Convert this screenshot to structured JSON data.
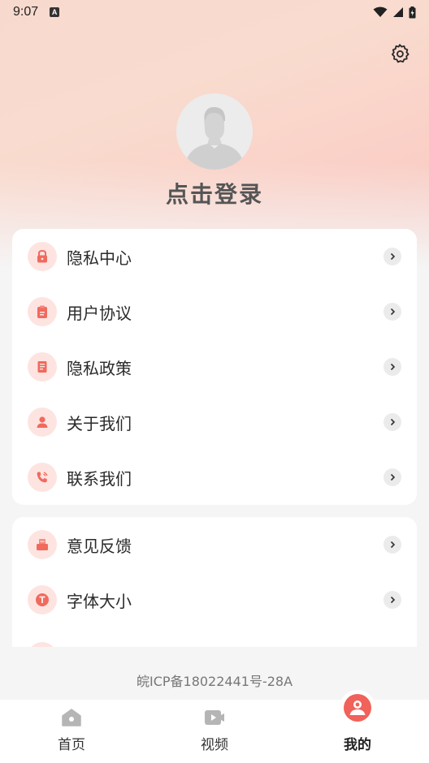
{
  "status_bar": {
    "time": "9:07",
    "notification_badge": "A"
  },
  "header": {
    "login_text": "点击登录"
  },
  "menu_group_1": [
    {
      "label": "隐私中心",
      "icon": "lock-icon"
    },
    {
      "label": "用户协议",
      "icon": "clipboard-icon"
    },
    {
      "label": "隐私政策",
      "icon": "document-icon"
    },
    {
      "label": "关于我们",
      "icon": "person-icon"
    },
    {
      "label": "联系我们",
      "icon": "phone-icon"
    }
  ],
  "menu_group_2": [
    {
      "label": "意见反馈",
      "icon": "feedback-icon"
    },
    {
      "label": "字体大小",
      "icon": "font-size-icon"
    }
  ],
  "footer": {
    "icp": "皖ICP备18022441号-28A"
  },
  "tabbar": [
    {
      "label": "首页",
      "icon": "home-icon"
    },
    {
      "label": "视频",
      "icon": "video-icon"
    },
    {
      "label": "我的",
      "icon": "profile-icon",
      "active": true
    }
  ],
  "colors": {
    "accent": "#f0625a",
    "icon_bg": "#fde4e1",
    "hero_gradient": "#f8c7c0"
  }
}
